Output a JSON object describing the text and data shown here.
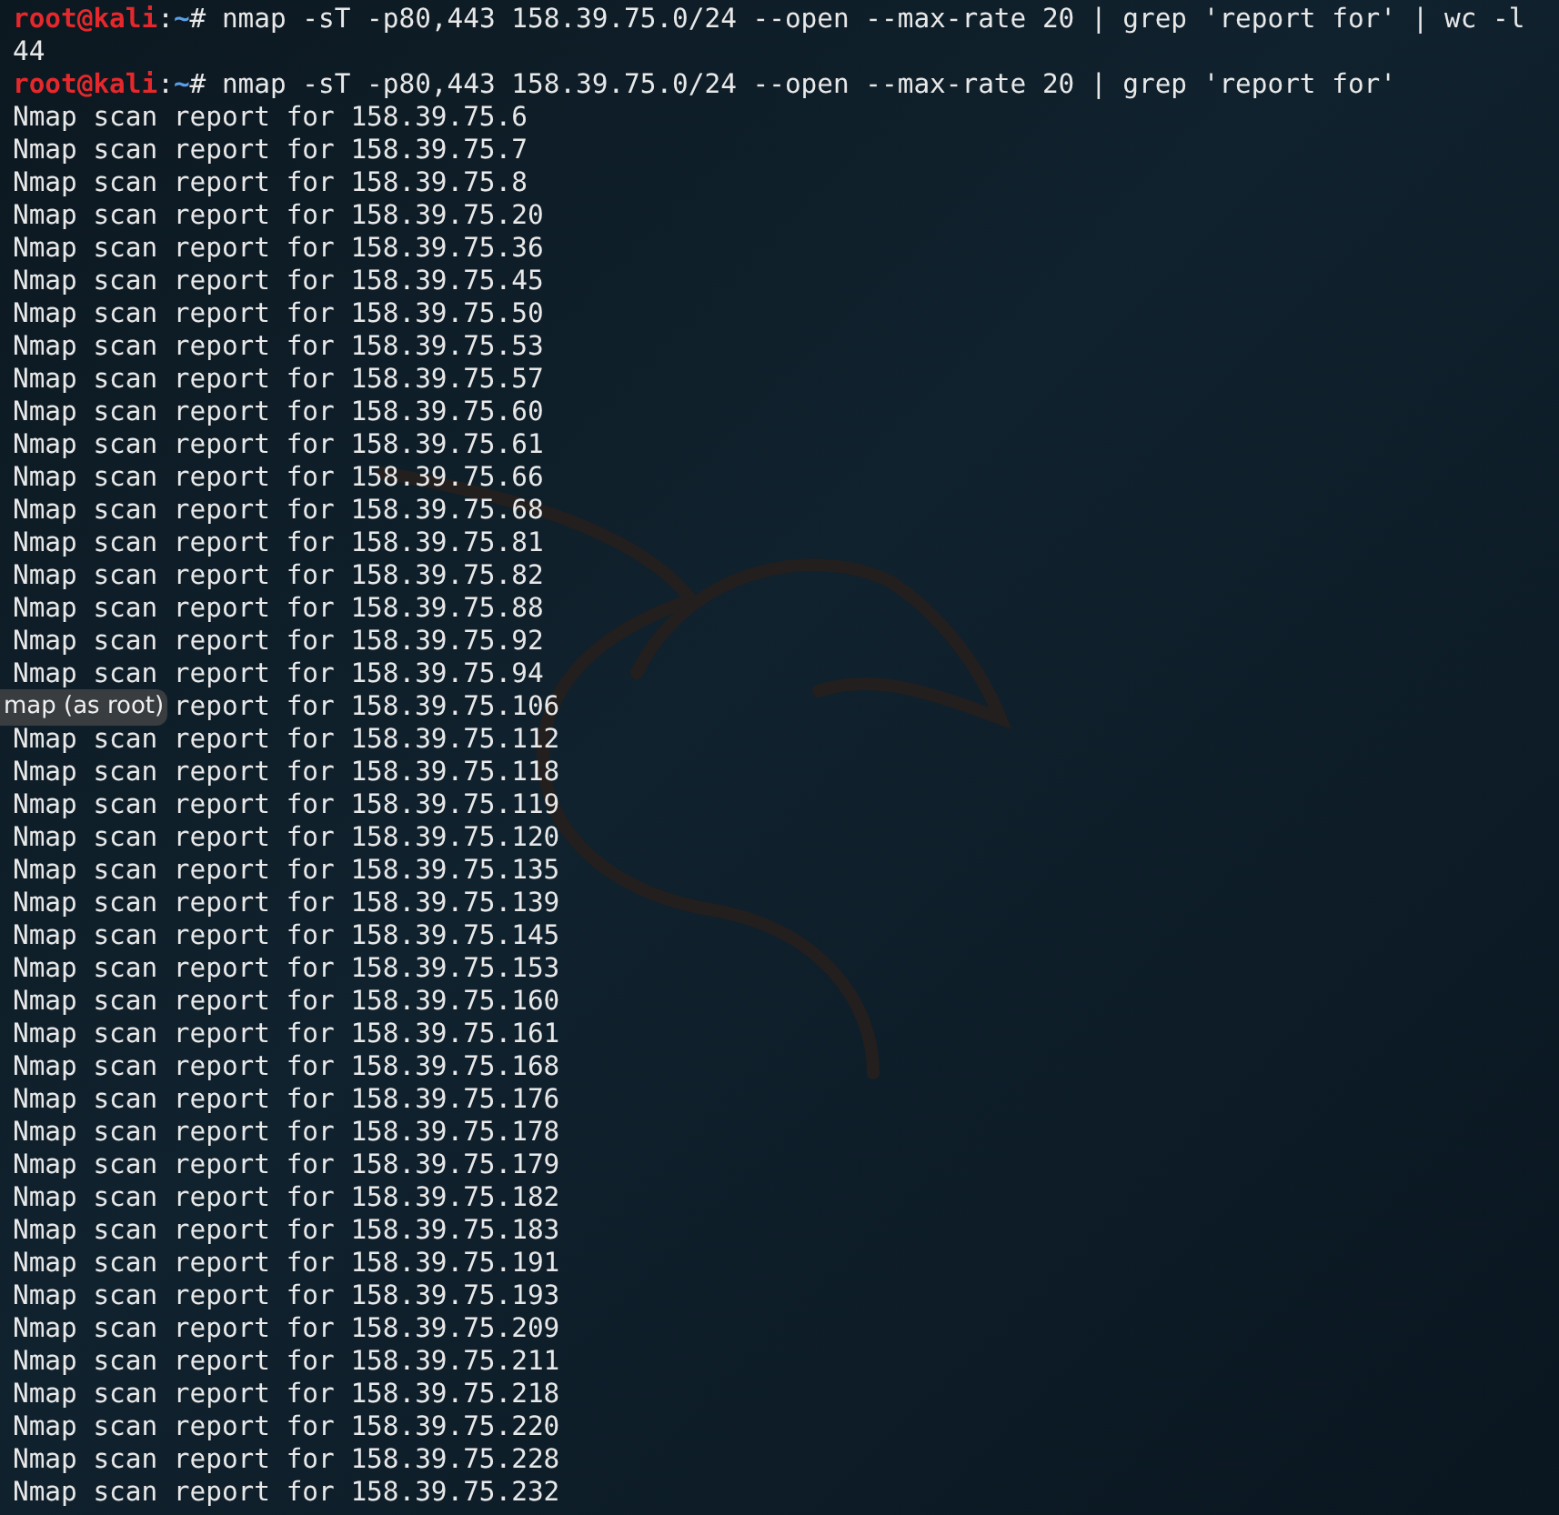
{
  "lines": [
    {
      "kind": "prompt",
      "user": "root@kali",
      "sep": ":",
      "path": "~",
      "symbol": "#",
      "command": "nmap -sT -p80,443 158.39.75.0/24 --open --max-rate 20 | grep 'report for' | wc -l"
    },
    {
      "kind": "output",
      "text": "44"
    },
    {
      "kind": "prompt",
      "user": "root@kali",
      "sep": ":",
      "path": "~",
      "symbol": "#",
      "command": "nmap -sT -p80,443 158.39.75.0/24 --open --max-rate 20 | grep 'report for'"
    },
    {
      "kind": "output",
      "text": "Nmap scan report for 158.39.75.6"
    },
    {
      "kind": "output",
      "text": "Nmap scan report for 158.39.75.7"
    },
    {
      "kind": "output",
      "text": "Nmap scan report for 158.39.75.8"
    },
    {
      "kind": "output",
      "text": "Nmap scan report for 158.39.75.20"
    },
    {
      "kind": "output",
      "text": "Nmap scan report for 158.39.75.36"
    },
    {
      "kind": "output",
      "text": "Nmap scan report for 158.39.75.45"
    },
    {
      "kind": "output",
      "text": "Nmap scan report for 158.39.75.50"
    },
    {
      "kind": "output",
      "text": "Nmap scan report for 158.39.75.53"
    },
    {
      "kind": "output",
      "text": "Nmap scan report for 158.39.75.57"
    },
    {
      "kind": "output",
      "text": "Nmap scan report for 158.39.75.60"
    },
    {
      "kind": "output",
      "text": "Nmap scan report for 158.39.75.61"
    },
    {
      "kind": "output",
      "text": "Nmap scan report for 158.39.75.66"
    },
    {
      "kind": "output",
      "text": "Nmap scan report for 158.39.75.68"
    },
    {
      "kind": "output",
      "text": "Nmap scan report for 158.39.75.81"
    },
    {
      "kind": "output",
      "text": "Nmap scan report for 158.39.75.82"
    },
    {
      "kind": "output",
      "text": "Nmap scan report for 158.39.75.88"
    },
    {
      "kind": "output",
      "text": "Nmap scan report for 158.39.75.92"
    },
    {
      "kind": "output",
      "text": "Nmap scan report for 158.39.75.94"
    },
    {
      "kind": "output",
      "text": "report for 158.39.75.106",
      "covered": true
    },
    {
      "kind": "output",
      "text": "Nmap scan report for 158.39.75.112"
    },
    {
      "kind": "output",
      "text": "Nmap scan report for 158.39.75.118"
    },
    {
      "kind": "output",
      "text": "Nmap scan report for 158.39.75.119"
    },
    {
      "kind": "output",
      "text": "Nmap scan report for 158.39.75.120"
    },
    {
      "kind": "output",
      "text": "Nmap scan report for 158.39.75.135"
    },
    {
      "kind": "output",
      "text": "Nmap scan report for 158.39.75.139"
    },
    {
      "kind": "output",
      "text": "Nmap scan report for 158.39.75.145"
    },
    {
      "kind": "output",
      "text": "Nmap scan report for 158.39.75.153"
    },
    {
      "kind": "output",
      "text": "Nmap scan report for 158.39.75.160"
    },
    {
      "kind": "output",
      "text": "Nmap scan report for 158.39.75.161"
    },
    {
      "kind": "output",
      "text": "Nmap scan report for 158.39.75.168"
    },
    {
      "kind": "output",
      "text": "Nmap scan report for 158.39.75.176"
    },
    {
      "kind": "output",
      "text": "Nmap scan report for 158.39.75.178"
    },
    {
      "kind": "output",
      "text": "Nmap scan report for 158.39.75.179"
    },
    {
      "kind": "output",
      "text": "Nmap scan report for 158.39.75.182"
    },
    {
      "kind": "output",
      "text": "Nmap scan report for 158.39.75.183"
    },
    {
      "kind": "output",
      "text": "Nmap scan report for 158.39.75.191"
    },
    {
      "kind": "output",
      "text": "Nmap scan report for 158.39.75.193"
    },
    {
      "kind": "output",
      "text": "Nmap scan report for 158.39.75.209"
    },
    {
      "kind": "output",
      "text": "Nmap scan report for 158.39.75.211"
    },
    {
      "kind": "output",
      "text": "Nmap scan report for 158.39.75.218"
    },
    {
      "kind": "output",
      "text": "Nmap scan report for 158.39.75.220"
    },
    {
      "kind": "output",
      "text": "Nmap scan report for 158.39.75.228"
    },
    {
      "kind": "output",
      "text": "Nmap scan report for 158.39.75.232"
    }
  ],
  "tooltip": {
    "text": "map (as root)"
  }
}
